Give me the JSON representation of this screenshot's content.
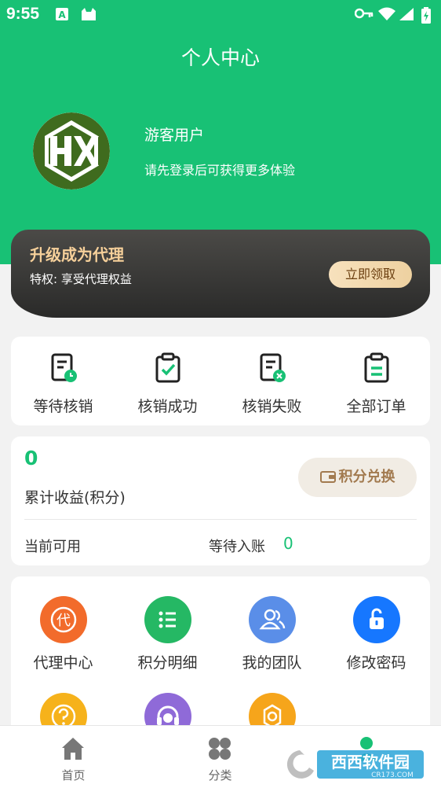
{
  "status_bar": {
    "time": "9:55"
  },
  "header": {
    "title": "个人中心",
    "username": "游客用户",
    "login_hint": "请先登录后可获得更多体验",
    "avatar_text": "HX"
  },
  "vip": {
    "title": "升级成为代理",
    "privilege": "特权: 享受代理权益",
    "button": "立即领取"
  },
  "orders": [
    {
      "label": "等待核销",
      "icon": "pending-doc-icon"
    },
    {
      "label": "核销成功",
      "icon": "check-clipboard-icon"
    },
    {
      "label": "核销失败",
      "icon": "fail-doc-icon"
    },
    {
      "label": "全部订单",
      "icon": "order-clipboard-icon"
    }
  ],
  "earnings": {
    "value": "0",
    "label": "累计收益(积分)",
    "exchange_button": "积分兑换",
    "available_label": "当前可用",
    "pending_label": "等待入账",
    "pending_value": "0"
  },
  "tools": [
    {
      "label": "代理中心",
      "icon": "agent-icon",
      "color": "#f26b2b"
    },
    {
      "label": "积分明细",
      "icon": "list-icon",
      "color": "#25b864"
    },
    {
      "label": "我的团队",
      "icon": "team-icon",
      "color": "#5a8ee8"
    },
    {
      "label": "修改密码",
      "icon": "lock-icon",
      "color": "#1677ff"
    },
    {
      "label": "",
      "icon": "help-icon",
      "color": "#f6b21b"
    },
    {
      "label": "",
      "icon": "headset-icon",
      "color": "#8f6ad8"
    },
    {
      "label": "",
      "icon": "settings-icon",
      "color": "#f6a51b"
    }
  ],
  "tabbar": [
    {
      "label": "首页",
      "icon": "home-icon"
    },
    {
      "label": "分类",
      "icon": "category-icon"
    },
    {
      "label": "",
      "icon": "profile-icon"
    }
  ],
  "watermark": {
    "text": "西西软件园",
    "sub": "CR173.COM"
  },
  "colors": {
    "primary": "#18c175",
    "vip_dark": "#2f2f2e",
    "vip_gold": "#f6d09a"
  }
}
